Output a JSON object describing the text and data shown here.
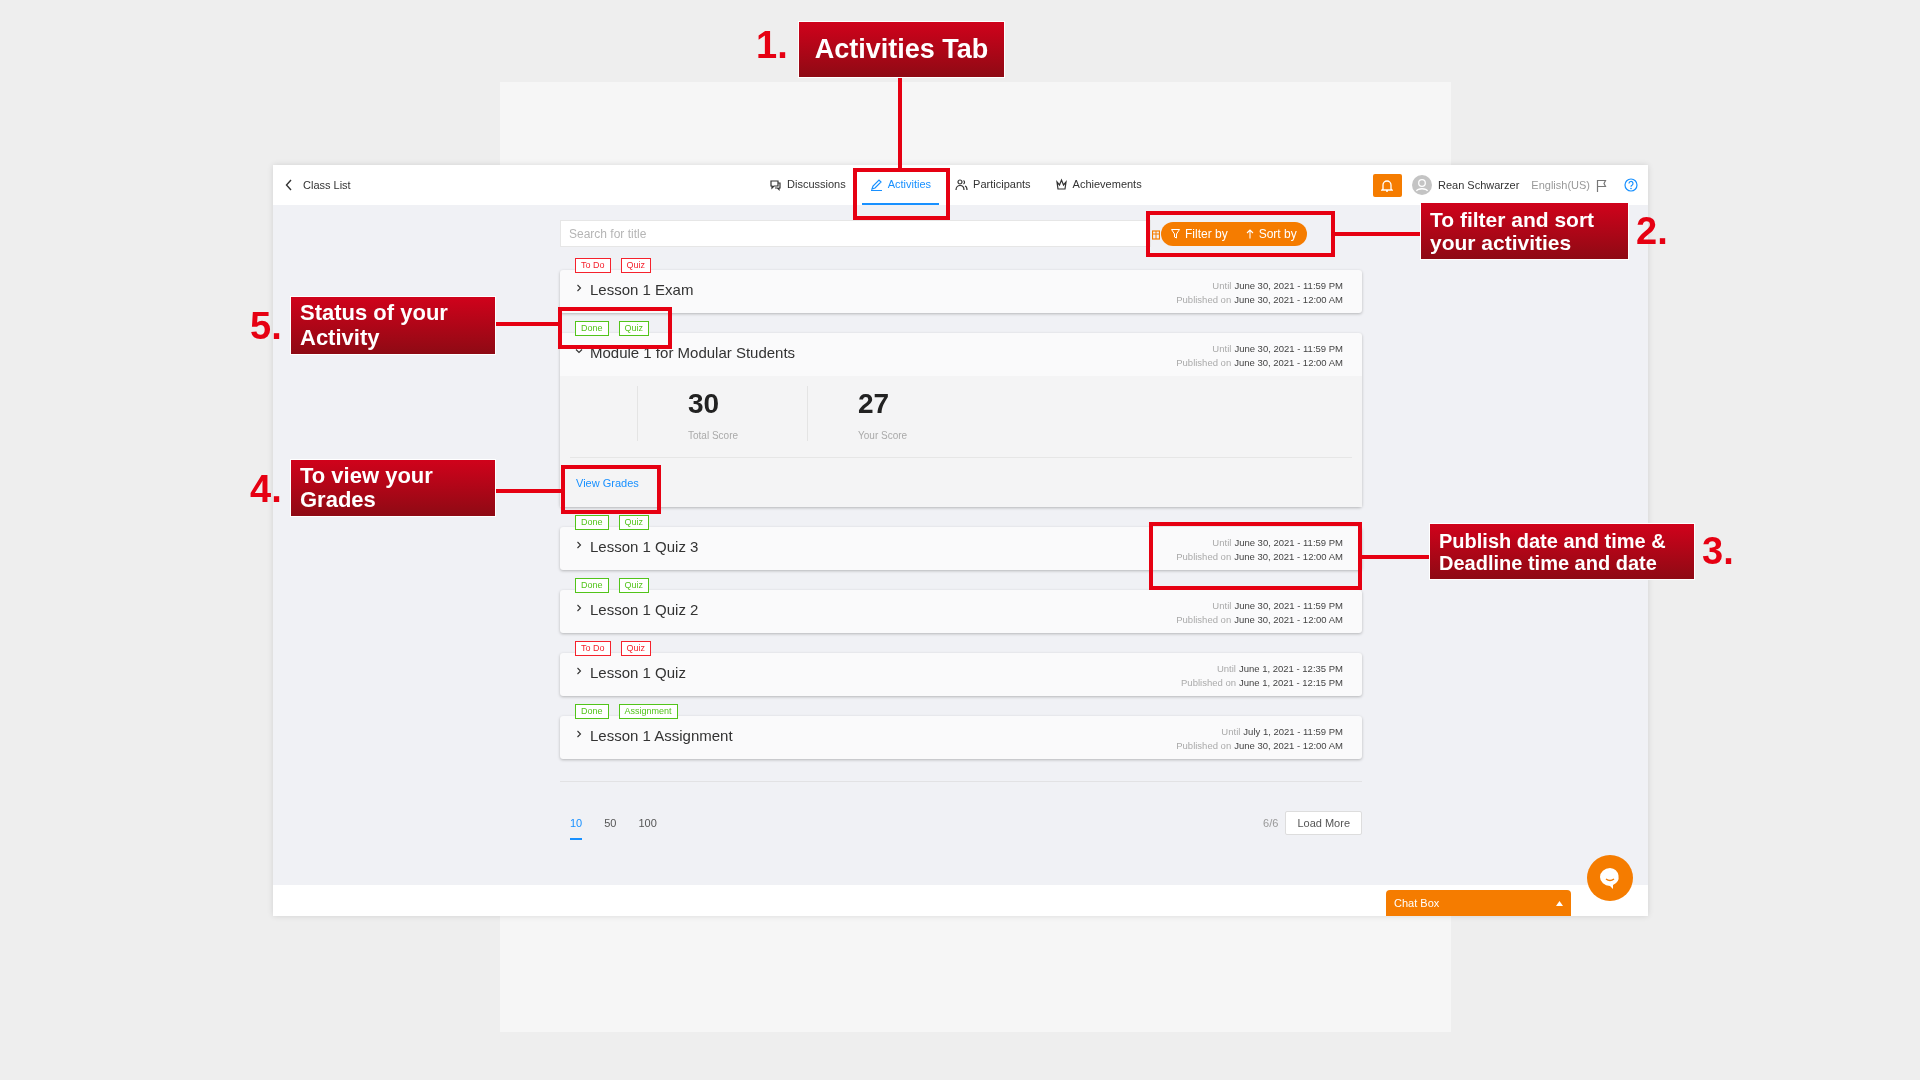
{
  "annotations": [
    {
      "number": "1.",
      "text": "Activities Tab"
    },
    {
      "number": "2.",
      "text": "To filter and sort your activities"
    },
    {
      "number": "5.",
      "text": "Status of your Activity"
    },
    {
      "number": "4.",
      "text": "To view your Grades"
    },
    {
      "number": "3.",
      "text": "Publish date and time & Deadline time and date"
    }
  ],
  "top_bar": {
    "back": "Class List",
    "tabs": [
      {
        "kind": "discussions",
        "label": "Discussions",
        "selected": false
      },
      {
        "kind": "activities",
        "label": "Activities",
        "selected": true
      },
      {
        "kind": "participants",
        "label": "Participants",
        "selected": false
      },
      {
        "kind": "achievements",
        "label": "Achievements",
        "selected": false
      }
    ],
    "user_name": "Rean Schwarzer",
    "language": "English(US)"
  },
  "search": {
    "placeholder": "Search for title"
  },
  "filter_button": "Filter by",
  "sort_button": "Sort by",
  "activities": [
    {
      "tags": [
        {
          "label": "To Do",
          "color": "#f5222d"
        },
        {
          "label": "Quiz",
          "color": "#f5222d"
        }
      ],
      "title": "Lesson 1 Exam",
      "expanded": false,
      "until_label": "Until",
      "until": "June 30, 2021 - 11:59 PM",
      "published_label": "Published on",
      "published": "June 30, 2021 - 12:00 AM"
    },
    {
      "tags": [
        {
          "label": "Done",
          "color": "#52c41a"
        },
        {
          "label": "Quiz",
          "color": "#52c41a"
        }
      ],
      "title": "Module 1 for Modular Students",
      "expanded": true,
      "until_label": "Until",
      "until": "June 30, 2021 - 11:59 PM",
      "published_label": "Published on",
      "published": "June 30, 2021 - 12:00 AM",
      "scores": [
        {
          "value": "30",
          "label": "Total Score"
        },
        {
          "value": "27",
          "label": "Your Score"
        }
      ],
      "link": "View Grades"
    },
    {
      "tags": [
        {
          "label": "Done",
          "color": "#52c41a"
        },
        {
          "label": "Quiz",
          "color": "#52c41a"
        }
      ],
      "title": "Lesson 1 Quiz 3",
      "expanded": false,
      "until_label": "Until",
      "until": "June 30, 2021 - 11:59 PM",
      "published_label": "Published on",
      "published": "June 30, 2021 - 12:00 AM"
    },
    {
      "tags": [
        {
          "label": "Done",
          "color": "#52c41a"
        },
        {
          "label": "Quiz",
          "color": "#52c41a"
        }
      ],
      "title": "Lesson 1 Quiz 2",
      "expanded": false,
      "until_label": "Until",
      "until": "June 30, 2021 - 11:59 PM",
      "published_label": "Published on",
      "published": "June 30, 2021 - 12:00 AM"
    },
    {
      "tags": [
        {
          "label": "To Do",
          "color": "#f5222d"
        },
        {
          "label": "Quiz",
          "color": "#f5222d"
        }
      ],
      "title": "Lesson 1 Quiz",
      "expanded": false,
      "until_label": "Until",
      "until": "June 1, 2021 - 12:35 PM",
      "published_label": "Published on",
      "published": "June 1, 2021 - 12:15 PM"
    },
    {
      "tags": [
        {
          "label": "Done",
          "color": "#52c41a"
        },
        {
          "label": "Assignment",
          "color": "#52c41a"
        }
      ],
      "title": "Lesson 1 Assignment",
      "expanded": false,
      "until_label": "Until",
      "until": "July 1, 2021 - 11:59 PM",
      "published_label": "Published on",
      "published": "June 30, 2021 - 12:00 AM"
    }
  ],
  "page_sizes": [
    {
      "label": "10",
      "selected": true
    },
    {
      "label": "50",
      "selected": false
    },
    {
      "label": "100",
      "selected": false
    }
  ],
  "count": "6/6",
  "load_more": "Load More",
  "chat_box": "Chat Box"
}
